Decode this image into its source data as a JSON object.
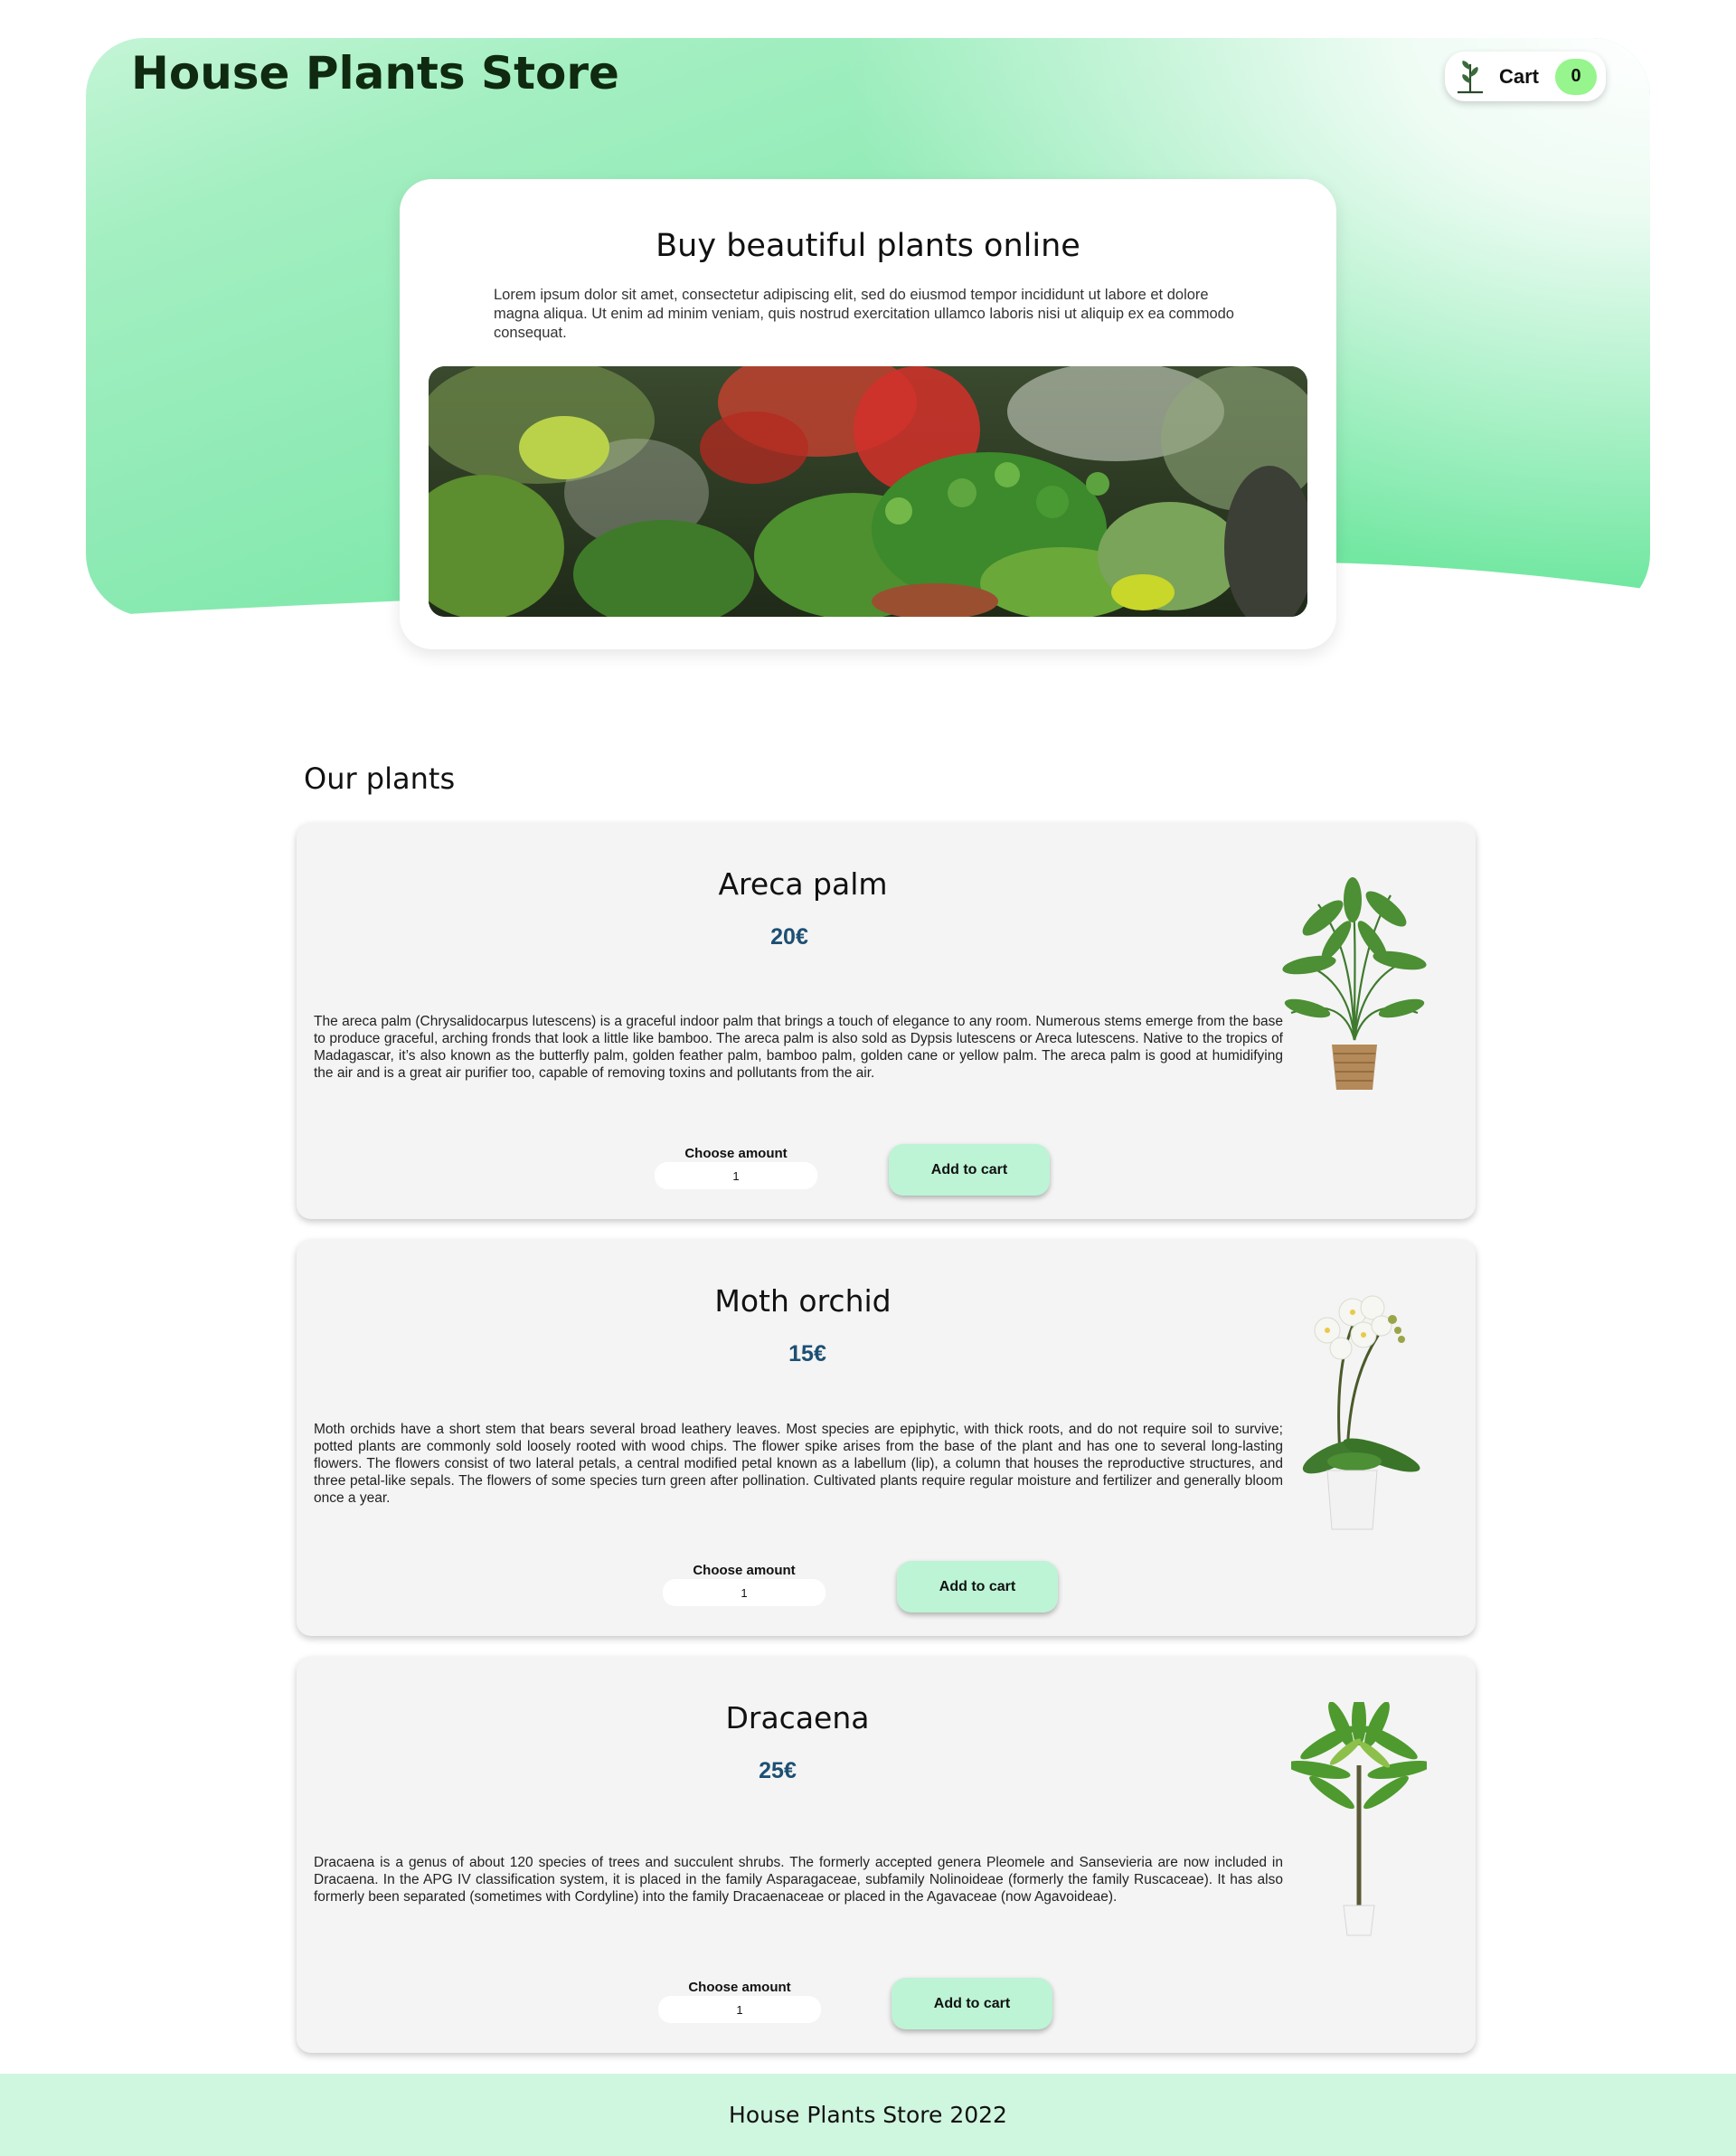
{
  "header": {
    "site_title": "House Plants Store",
    "cart_label": "Cart",
    "cart_count": "0",
    "cart_icon": "plant-icon"
  },
  "hero": {
    "title": "Buy beautiful plants online",
    "text": "Lorem ipsum dolor sit amet, consectetur adipiscing elit, sed do eiusmod tempor incididunt ut labore et dolore magna aliqua. Ut enim ad minim veniam, quis nostrud exercitation ullamco laboris nisi ut aliquip ex ea commodo consequat.",
    "image": "plants-photo"
  },
  "plants_section": {
    "title": "Our plants",
    "amount_label": "Choose amount",
    "add_label": "Add to cart",
    "items": [
      {
        "name": "Areca palm",
        "price": "20€",
        "amount": "1",
        "image": "areca-palm-photo",
        "description": "The areca palm (Chrysalidocarpus lutescens) is a graceful indoor palm that brings a touch of elegance to any room. Numerous stems emerge from the base to produce graceful, arching fronds that look a little like bamboo. The areca palm is also sold as Dypsis lutescens or Areca lutescens. Native to the tropics of Madagascar, it’s also known as the butterfly palm, golden feather palm, bamboo palm, golden cane or yellow palm. The areca palm is good at humidifying the air and is a great air purifier too, capable of removing toxins and pollutants from the air."
      },
      {
        "name": "Moth orchid",
        "price": "15€",
        "amount": "1",
        "image": "moth-orchid-photo",
        "description": "Moth orchids have a short stem that bears several broad leathery leaves. Most species are epiphytic, with thick roots, and do not require soil to survive; potted plants are commonly sold loosely rooted with wood chips. The flower spike arises from the base of the plant and has one to several long-lasting flowers. The flowers consist of two lateral petals, a central modified petal known as a labellum (lip), a column that houses the reproductive structures, and three petal-like sepals. The flowers of some species turn green after pollination. Cultivated plants require regular moisture and fertilizer and generally bloom once a year."
      },
      {
        "name": "Dracaena",
        "price": "25€",
        "amount": "1",
        "image": "dracaena-photo",
        "description": "Dracaena is a genus of about 120 species of trees and succulent shrubs. The formerly accepted genera Pleomele and Sansevieria are now included in Dracaena. In the APG IV classification system, it is placed in the family Asparagaceae, subfamily Nolinoideae (formerly the family Ruscaceae). It has also formerly been separated (sometimes with Cordyline) into the family Dracaenaceae or placed in the Agavaceae (now Agavoideae)."
      }
    ]
  },
  "footer": {
    "text": "House Plants Store 2022"
  },
  "colors": {
    "hero_green": "#78e8a6",
    "accent_button": "#bdf4d6",
    "price_blue": "#1d4f73",
    "cart_badge": "#96f58c",
    "footer_bg": "#cff6df"
  }
}
